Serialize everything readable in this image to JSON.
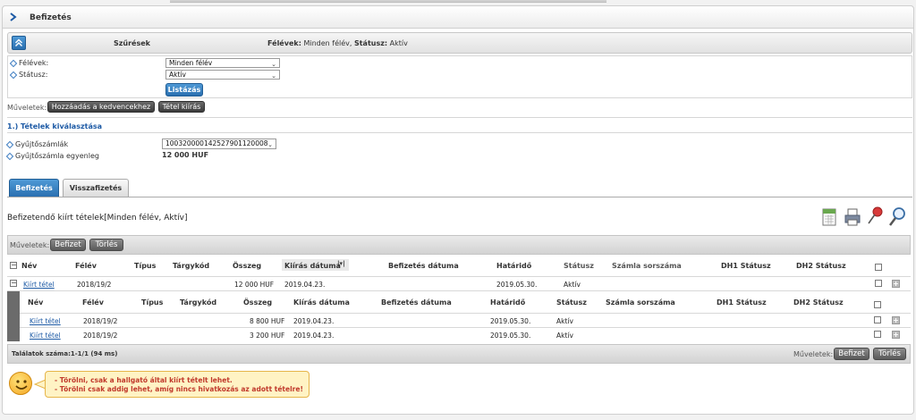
{
  "page": {
    "title": "Befizetés"
  },
  "filters": {
    "header_label": "Szűrések",
    "summary_key1": "Félévek:",
    "summary_val1": "Minden félév,",
    "summary_key2": "Státusz:",
    "summary_val2": "Aktív",
    "felevek_label": "Félévek:",
    "felevek_value": "Minden félév",
    "statusz_label": "Státusz:",
    "statusz_value": "Aktív",
    "list_button": "Listázás"
  },
  "top_ops": {
    "label": "Műveletek:",
    "fav_button": "Hozzáadás a kedvencekhez",
    "print_button": "Tétel kiírás"
  },
  "section1": {
    "title": "1.) Tételek kiválasztása",
    "gyujto_label": "Gyűjtőszámlák",
    "gyujto_value": "10032000014252790112000​8",
    "egyenleg_label": "Gyűjtőszámla egyenleg",
    "egyenleg_value": "12 000 HUF"
  },
  "tabs": [
    {
      "label": "Befizetés"
    },
    {
      "label": "Visszafizetés"
    }
  ],
  "list": {
    "title": "Befizetendő kiírt tételek[Minden félév, Aktív]",
    "ops_label": "Műveletek:",
    "pay_button": "Befizet",
    "delete_button": "Törlés",
    "columns": [
      "Név",
      "Félév",
      "Típus",
      "Tárgykód",
      "Összeg",
      "Kiírás dátuma",
      "Befizetés dátuma",
      "Határidő",
      "Státusz",
      "Számla sorszáma",
      "DH1 Státusz",
      "DH2 Státusz"
    ],
    "row": {
      "name": "Kiírt tétel",
      "felev": "2018/19/2",
      "osszeg": "12 000 HUF",
      "kiiras": "2019.04.23.",
      "hatarido": "2019.05.30.",
      "statusz": "Aktív"
    },
    "subcolumns": [
      "Név",
      "Félév",
      "Típus",
      "Tárgykód",
      "Összeg",
      "Kiírás dátuma",
      "Befizetés dátuma",
      "Határidő",
      "Státusz",
      "Számla sorszáma",
      "DH1 Státusz",
      "DH2 Státusz"
    ],
    "subrows": [
      {
        "name": "Kiírt tétel",
        "felev": "2018/19/2",
        "osszeg": "8 800 HUF",
        "kiiras": "2019.04.23.",
        "hatarido": "2019.05.30.",
        "statusz": "Aktív"
      },
      {
        "name": "Kiírt tétel",
        "felev": "2018/19/2",
        "osszeg": "3 200 HUF",
        "kiiras": "2019.04.23.",
        "hatarido": "2019.05.30.",
        "statusz": "Aktív"
      }
    ],
    "count_text": "Találatok száma:1-1/1 (94 ms)",
    "footer_ops_label": "Műveletek:",
    "footer_pay_button": "Befizet",
    "footer_delete_button": "Törlés"
  },
  "notice": {
    "line1": "- Törölni, csak a hallgató által kiírt tételt lehet.",
    "line2": "- Törölni csak addig lehet, amíg nincs hivatkozás az adott tételre!"
  },
  "icons": [
    "excel-export-icon",
    "print-icon",
    "pin-icon",
    "search-icon",
    "smiley-icon",
    "chevron-right-icon",
    "collapse-up-icon"
  ],
  "colors": {
    "accent": "#2a6fb0",
    "link": "#1d5aa5",
    "notice_bg": "#fff3c4",
    "notice_text": "#c0392b"
  }
}
